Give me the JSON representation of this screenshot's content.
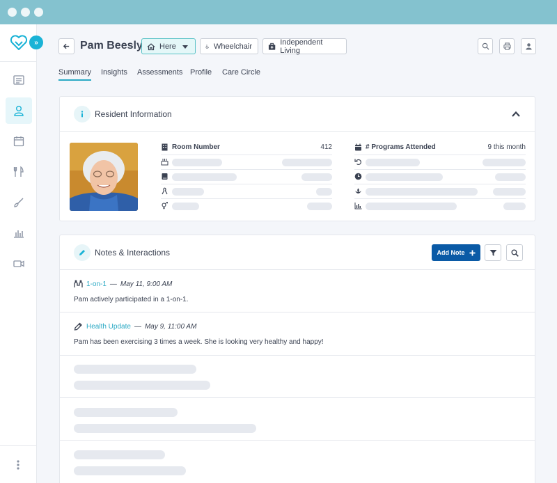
{
  "resident": {
    "name": "Pam Beesly",
    "status": "Here",
    "tags": [
      "Wheelchair",
      "Independent Living"
    ]
  },
  "tabs": [
    "Summary",
    "Insights",
    "Assessments",
    "Profile",
    "Care Circle"
  ],
  "resident_info": {
    "title": "Resident Information",
    "left": [
      {
        "label": "Room Number",
        "value": "412",
        "icon": "building-icon"
      },
      {
        "label": "",
        "value": "",
        "icon": "cake-icon"
      },
      {
        "label": "",
        "value": "",
        "icon": "book-icon"
      },
      {
        "label": "",
        "value": "",
        "icon": "ribbon-icon"
      },
      {
        "label": "",
        "value": "",
        "icon": "gender-icon"
      }
    ],
    "right": [
      {
        "label": "# Programs Attended",
        "value": "9 this month",
        "icon": "calendar-icon"
      },
      {
        "label": "",
        "value": "",
        "icon": "undo-icon"
      },
      {
        "label": "",
        "value": "",
        "icon": "clock-icon"
      },
      {
        "label": "",
        "value": "",
        "icon": "lotus-icon"
      },
      {
        "label": "",
        "value": "",
        "icon": "bar-chart-icon"
      }
    ]
  },
  "notes": {
    "title": "Notes & Interactions",
    "add_label": "Add Note",
    "items": [
      {
        "type": "1-on-1",
        "separator": "—",
        "date": "May 11, 9:00 AM",
        "body": "Pam actively participated in a 1-on-1.",
        "icon": "people-icon"
      },
      {
        "type": "Health Update",
        "separator": "—",
        "date": "May 9, 11:00 AM",
        "body": "Pam has been exercising 3 times a week. She is looking very healthy and happy!",
        "icon": "pencil-icon"
      }
    ]
  },
  "colors": {
    "titlebar": "#84c2cf",
    "accent": "#2aa9c4",
    "primary_button": "#0a5aa6",
    "here_badge": "#e4f7f8"
  }
}
